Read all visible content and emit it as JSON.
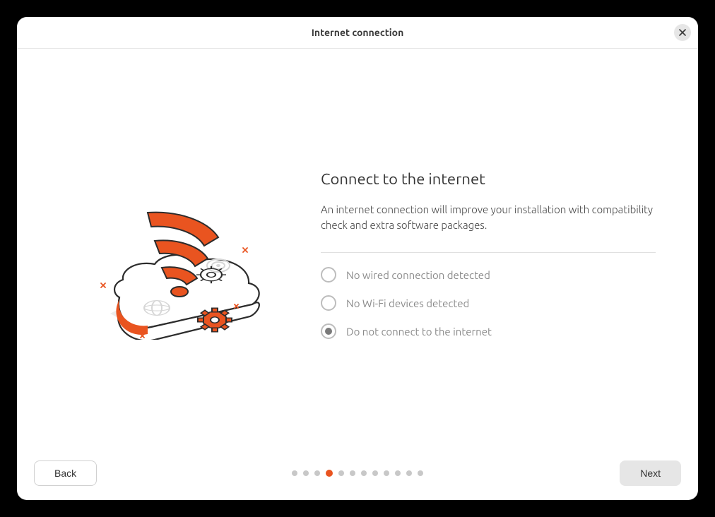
{
  "titlebar": {
    "title": "Internet connection"
  },
  "main": {
    "heading": "Connect to the internet",
    "description": "An internet connection will improve your installation with compatibility check and extra software packages.",
    "options": [
      {
        "label": "No wired connection detected",
        "selected": false,
        "enabled": false
      },
      {
        "label": "No Wi-Fi devices detected",
        "selected": false,
        "enabled": false
      },
      {
        "label": "Do not connect to the internet",
        "selected": true,
        "enabled": true
      }
    ]
  },
  "footer": {
    "back_label": "Back",
    "next_label": "Next",
    "step_count": 12,
    "active_step": 3
  },
  "colors": {
    "accent": "#e95420"
  },
  "icons": {
    "close": "close-icon",
    "illustration": "wifi-cloud-gears"
  }
}
